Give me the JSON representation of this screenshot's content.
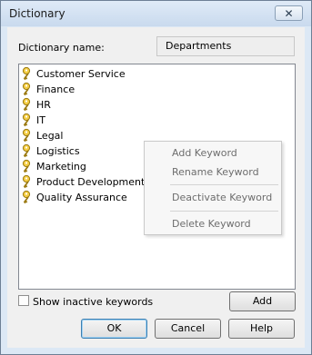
{
  "window": {
    "title": "Dictionary",
    "close_glyph": "✕"
  },
  "form": {
    "name_label": "Dictionary name:",
    "name_value": "Departments"
  },
  "keywords": [
    "Customer Service",
    "Finance",
    "HR",
    "IT",
    "Legal",
    "Logistics",
    "Marketing",
    "Product Development",
    "Quality Assurance"
  ],
  "context_menu": {
    "add": "Add Keyword",
    "rename": "Rename Keyword",
    "deactivate": "Deactivate Keyword",
    "delete": "Delete Keyword"
  },
  "show_inactive": {
    "label": "Show inactive keywords",
    "checked": false
  },
  "buttons": {
    "add": "Add",
    "ok": "OK",
    "cancel": "Cancel",
    "help": "Help"
  },
  "icons": {
    "keyword": "key-icon"
  }
}
